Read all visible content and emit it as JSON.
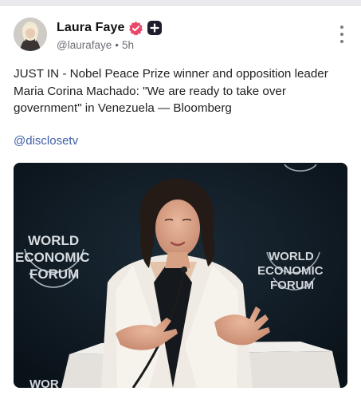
{
  "post": {
    "author_name": "Laura Faye",
    "handle": "@laurafaye",
    "separator": "•",
    "time_ago": "5h",
    "text": "JUST IN - Nobel Peace Prize winner and opposition leader Maria Corina Machado: \"We are ready to take over government\" in Venezuela — Bloomberg",
    "mention": "@disclosetv"
  },
  "media": {
    "brand_left_line1": "WORLD",
    "brand_left_line2": "ECONOMIC",
    "brand_left_line3": "FORUM",
    "brand_right_line1": "WORLD",
    "brand_right_line2": "ECONOMIC",
    "brand_right_line3": "FORUM",
    "brand_bottom": "WOR"
  },
  "colors": {
    "accent_mention": "#3f5fa8",
    "verified_badge": "#e8496b",
    "plus_badge": "#1e1e2a"
  },
  "icons": {
    "verified": "verified-badge-icon",
    "plus": "plus-badge-icon",
    "more": "more-options-icon"
  }
}
